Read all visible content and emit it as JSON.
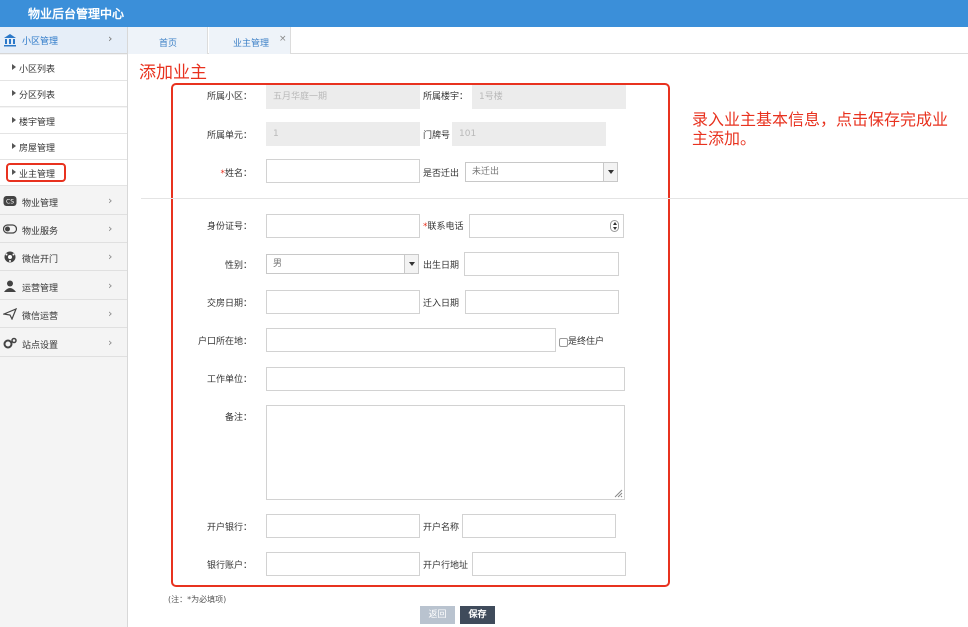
{
  "header": {
    "title": "物业后台管理中心"
  },
  "sidebar": {
    "group": {
      "label": "小区管理"
    },
    "subitems": [
      {
        "label": "小区列表"
      },
      {
        "label": "分区列表"
      },
      {
        "label": "楼宇管理"
      },
      {
        "label": "房屋管理"
      },
      {
        "label": "业主管理"
      }
    ],
    "menus": [
      {
        "label": "物业管理"
      },
      {
        "label": "物业服务"
      },
      {
        "label": "微信开门"
      },
      {
        "label": "运营管理"
      },
      {
        "label": "微信运营"
      },
      {
        "label": "站点设置"
      }
    ]
  },
  "tabs": [
    {
      "label": "首页"
    },
    {
      "label": "业主管理",
      "close": "×"
    }
  ],
  "page": {
    "title": "添加业主",
    "annotation": "录入业主基本信息，点击保存完成业主添加。"
  },
  "form": {
    "community_label": "所属小区：",
    "community_value": "五月华庭一期",
    "building_label": "所属楼宇：",
    "building_value": "1号楼",
    "unit_label": "所属单元：",
    "unit_value": "1",
    "door_label": "门牌号",
    "door_value": "101",
    "name_req": "*",
    "name_label": "姓名：",
    "moved_label": "是否迁出",
    "moved_value": "未迁出",
    "id_label": "身份证号：",
    "phone_req": "*",
    "phone_label": "联系电话",
    "gender_label": "性别：",
    "gender_value": "男",
    "birth_label": "出生日期",
    "handover_label": "交房日期：",
    "movein_label": "迁入日期",
    "hukou_label": "户口所在地：",
    "final_resident_label": "是终住户",
    "work_label": "工作单位：",
    "remark_label": "备注：",
    "bank_label": "开户银行：",
    "account_name_label": "开户名称",
    "bank_account_label": "银行账户：",
    "bank_address_label": "开户行地址"
  },
  "footer": {
    "note": "(注：*为必填项)",
    "back_label": "返回",
    "save_label": "保存"
  }
}
